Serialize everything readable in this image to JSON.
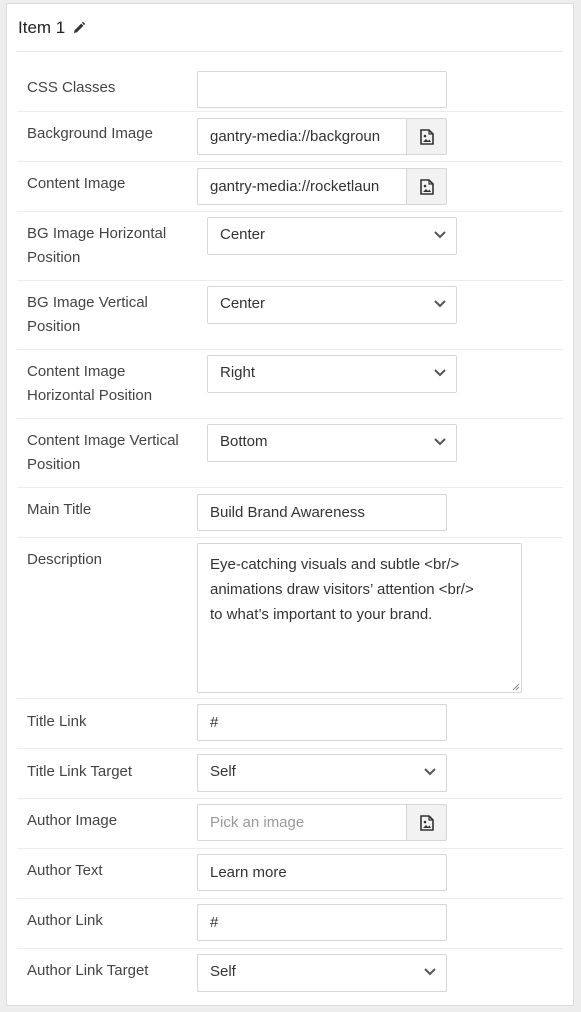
{
  "item": {
    "title": "Item 1",
    "edit_icon": "pencil-icon"
  },
  "fields": {
    "css_classes": {
      "label": "CSS Classes",
      "value": ""
    },
    "background_image": {
      "label": "Background Image",
      "value": "gantry-media://backgroun",
      "picker_icon": "image-file-icon"
    },
    "content_image": {
      "label": "Content Image",
      "value": "gantry-media://rocketlaun",
      "picker_icon": "image-file-icon"
    },
    "bg_h_position": {
      "label_line1": "BG Image Horizontal",
      "label_line2": "Position",
      "value": "Center"
    },
    "bg_v_position": {
      "label_line1": "BG Image Vertical",
      "label_line2": "Position",
      "value": "Center"
    },
    "content_h_position": {
      "label_line1": "Content Image",
      "label_line2": "Horizontal Position",
      "value": "Right"
    },
    "content_v_position": {
      "label_line1": "Content Image Vertical",
      "label_line2": "Position",
      "value": "Bottom"
    },
    "main_title": {
      "label": "Main Title",
      "value": "Build Brand Awareness"
    },
    "description": {
      "label": "Description",
      "line1": "Eye-catching visuals and subtle <br/>",
      "line2": "animations draw visitors’ attention <br/>",
      "line3": "to what’s important to your brand."
    },
    "title_link": {
      "label": "Title Link",
      "value": "#"
    },
    "title_link_target": {
      "label": "Title Link Target",
      "value": "Self"
    },
    "author_image": {
      "label": "Author Image",
      "placeholder": "Pick an image",
      "picker_icon": "image-file-icon"
    },
    "author_text": {
      "label": "Author Text",
      "value": "Learn more"
    },
    "author_link": {
      "label": "Author Link",
      "value": "#"
    },
    "author_link_target": {
      "label": "Author Link Target",
      "value": "Self"
    }
  },
  "colors": {
    "panel_bg": "#ffffff",
    "page_bg": "#ededed",
    "border": "#d6d6d6",
    "label_text": "#444444",
    "placeholder_text": "#9a9a9a"
  }
}
